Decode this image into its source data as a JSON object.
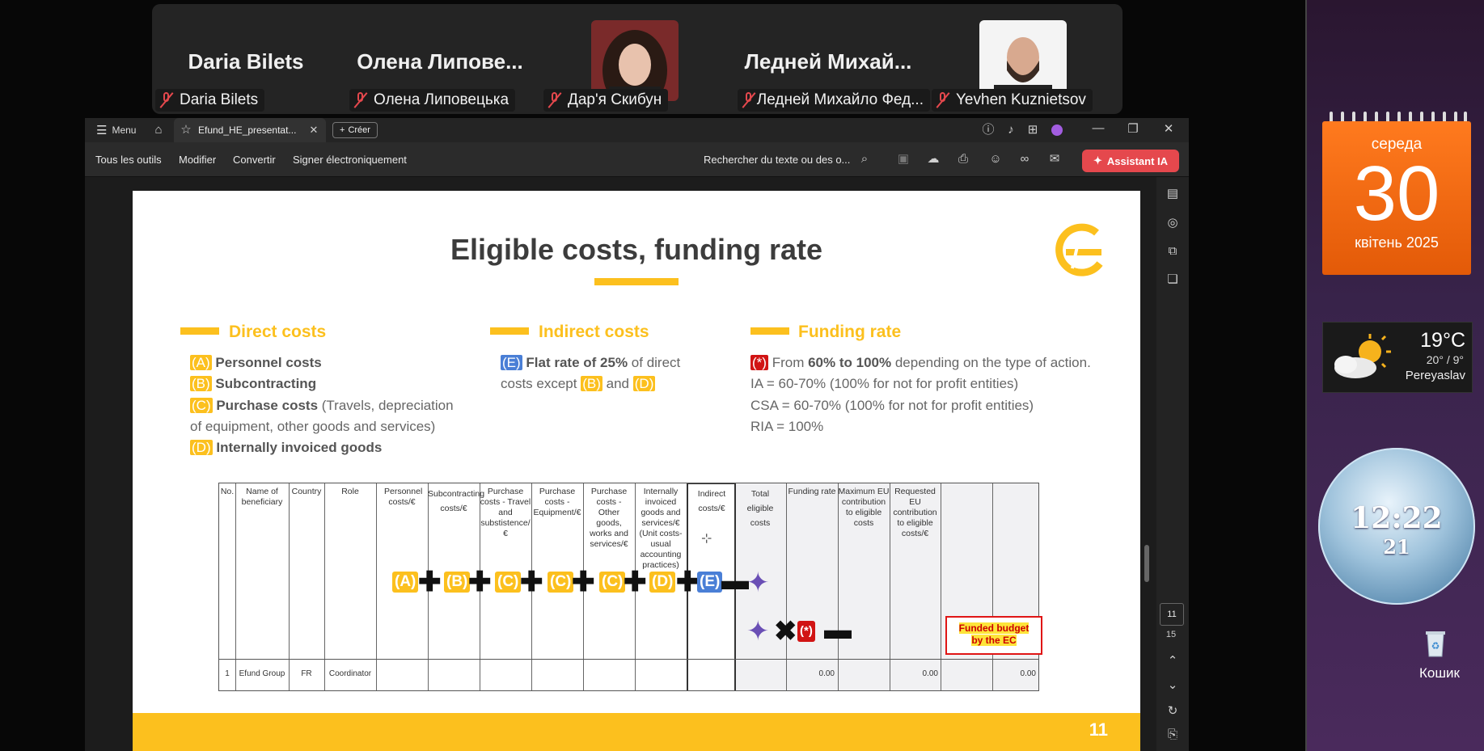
{
  "call": {
    "tiles": [
      {
        "big_name": "Daria Bilets",
        "label": "Daria Bilets"
      },
      {
        "big_name": "Олена  Липове...",
        "label": "Олена Липовецька"
      },
      {
        "big_name": "",
        "label": "Дар'я Скибун"
      },
      {
        "big_name": "Ледней  Михай...",
        "label": "Ледней Михайло Фед..."
      },
      {
        "big_name": "",
        "label": "Yevhen Kuznietsov"
      }
    ]
  },
  "reader": {
    "menu_label": "Menu",
    "tab_title": "Efund_HE_presentat...",
    "create_label": "Créer",
    "toolbar": {
      "all_tools": "Tous les outils",
      "edit": "Modifier",
      "convert": "Convertir",
      "sign": "Signer électroniquement",
      "search_placeholder": "Rechercher du texte ou des o...",
      "assistant": "Assistant IA"
    },
    "page_current": "11",
    "page_total": "15"
  },
  "slide": {
    "title": "Eligible costs, funding rate",
    "page_number": "11",
    "direct": {
      "heading": "Direct costs",
      "a_tag": "(A)",
      "a_text": "Personnel costs",
      "b_tag": "(B)",
      "b_text": "Subcontracting",
      "c_tag": "(C)",
      "c_text": "Purchase costs",
      "c_extra_1": "(Travels, depreciation",
      "c_extra_2": "of equipment, other goods and services)",
      "d_tag": "(D)",
      "d_text": "Internally invoiced goods"
    },
    "indirect": {
      "heading": "Indirect costs",
      "e_tag": "(E)",
      "e_bold": "Flat rate of 25%",
      "e_text": "of direct",
      "e_line2": "costs except",
      "and": "and",
      "b_tag": "(B)",
      "d_tag": "(D)"
    },
    "funding": {
      "heading": "Funding rate",
      "tag": "(*)",
      "from": "From",
      "range": "60% to 100%",
      "rest": "depending on the type of action.",
      "ia": "IA = 60-70% (100% for not for profit entities)",
      "csa": "CSA = 60-70% (100% for not for profit entities)",
      "ria": "RIA = 100%"
    },
    "table": {
      "headers": [
        "No.",
        "Name of beneficiary",
        "Country",
        "Role",
        "Personnel costs/€",
        "Subcontracting costs/€",
        "Purchase costs - Travel and substistence/€",
        "Purchase costs - Equipment/€",
        "Purchase costs - Other goods, works and services/€",
        "Internally invoiced goods and services/€",
        "Indirect costs/€",
        "Total eligible costs",
        "Funding rate",
        "Maximum EU contribution to eligible costs",
        "Requested EU contribution to eligible costs/€"
      ],
      "unit_note": "(Unit costs- usual accounting practices)",
      "row": [
        "1",
        "Efund Group",
        "FR",
        "Coordinator",
        "",
        "",
        "",
        "",
        "",
        "",
        "",
        "0.00",
        "",
        "0.00",
        "0.00"
      ],
      "tokens": [
        "(A)",
        "(B)",
        "(C)",
        "(C)",
        "(C)",
        "(D)",
        "(E)"
      ],
      "funding_token": "(*)",
      "funded_1": "Funded budget",
      "funded_2": "by the EC"
    }
  },
  "desktop": {
    "weekday": "середа",
    "day": "30",
    "month_year": "квітень 2025",
    "temp": "19°C",
    "temp_range": "20° / 9°",
    "city": "Pereyaslav",
    "time": "12:22",
    "seconds": "21",
    "bin_label": "Кошик"
  },
  "colors": {
    "accent": "#fcc01e",
    "blue_tag": "#4a7fd6",
    "red_tag": "#d11414",
    "assistant": "#e5484d"
  }
}
